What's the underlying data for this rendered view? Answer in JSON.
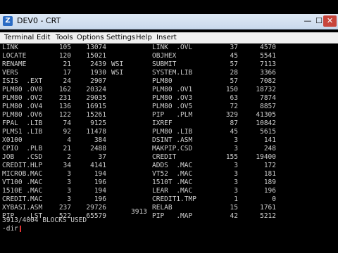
{
  "window": {
    "title": "DEV0 - CRT",
    "icon_name": "terminal-app-icon",
    "min_glyph": "—",
    "max_glyph": "☐",
    "close_glyph": "✕"
  },
  "menu": {
    "items": [
      "Terminal",
      "Edit",
      "Tools",
      "Options",
      "Settings",
      "Help",
      "Insert"
    ]
  },
  "listing": {
    "left": [
      {
        "name": "LINK",
        "blocks": "105",
        "size": "13074",
        "user": ""
      },
      {
        "name": "LOCATE",
        "blocks": "120",
        "size": "15021",
        "user": ""
      },
      {
        "name": "RENAME",
        "blocks": "21",
        "size": "2439",
        "user": "WSI"
      },
      {
        "name": "VERS",
        "blocks": "17",
        "size": "1930",
        "user": "WSI"
      },
      {
        "name": "ISIS  .EXT",
        "blocks": "24",
        "size": "2907",
        "user": ""
      },
      {
        "name": "PLM80 .OV0",
        "blocks": "162",
        "size": "20324",
        "user": ""
      },
      {
        "name": "PLM80 .OV2",
        "blocks": "231",
        "size": "29035",
        "user": ""
      },
      {
        "name": "PLM80 .OV4",
        "blocks": "136",
        "size": "16915",
        "user": ""
      },
      {
        "name": "PLM80 .OV6",
        "blocks": "122",
        "size": "15261",
        "user": ""
      },
      {
        "name": "FPAL  .LIB",
        "blocks": "74",
        "size": "9125",
        "user": ""
      },
      {
        "name": "PLMS1 .LIB",
        "blocks": "92",
        "size": "11478",
        "user": ""
      },
      {
        "name": "X0100",
        "blocks": "4",
        "size": "384",
        "user": ""
      },
      {
        "name": "CPIO  .PLB",
        "blocks": "21",
        "size": "2488",
        "user": ""
      },
      {
        "name": "JOB   .CSD",
        "blocks": "2",
        "size": "37",
        "user": ""
      },
      {
        "name": "CREDIT.HLP",
        "blocks": "34",
        "size": "4141",
        "user": ""
      },
      {
        "name": "MICROB.MAC",
        "blocks": "3",
        "size": "194",
        "user": ""
      },
      {
        "name": "VT100 .MAC",
        "blocks": "3",
        "size": "196",
        "user": ""
      },
      {
        "name": "1510E .MAC",
        "blocks": "3",
        "size": "194",
        "user": ""
      },
      {
        "name": "CREDIT.MAC",
        "blocks": "3",
        "size": "196",
        "user": ""
      },
      {
        "name": "XYBASI.ASM",
        "blocks": "237",
        "size": "29726",
        "user": ""
      },
      {
        "name": "PIP   .LST",
        "blocks": "522",
        "size": "65579",
        "user": ""
      }
    ],
    "right": [
      {
        "name": "LINK  .OVL",
        "blocks": "37",
        "size": "4570"
      },
      {
        "name": "OBJHEX",
        "blocks": "45",
        "size": "5541"
      },
      {
        "name": "SUBMIT",
        "blocks": "57",
        "size": "7113"
      },
      {
        "name": "SYSTEM.LIB",
        "blocks": "28",
        "size": "3366"
      },
      {
        "name": "PLM80",
        "blocks": "57",
        "size": "7082"
      },
      {
        "name": "PLM80 .OV1",
        "blocks": "150",
        "size": "18732"
      },
      {
        "name": "PLM80 .OV3",
        "blocks": "63",
        "size": "7874"
      },
      {
        "name": "PLM80 .OV5",
        "blocks": "72",
        "size": "8857"
      },
      {
        "name": "PIP   .PLM",
        "blocks": "329",
        "size": "41305"
      },
      {
        "name": "IXREF",
        "blocks": "87",
        "size": "10842"
      },
      {
        "name": "PLM80 .LIB",
        "blocks": "45",
        "size": "5615"
      },
      {
        "name": "DSINT .ASM",
        "blocks": "3",
        "size": "141"
      },
      {
        "name": "MAKPIP.CSD",
        "blocks": "3",
        "size": "248"
      },
      {
        "name": "CREDIT",
        "blocks": "155",
        "size": "19400"
      },
      {
        "name": "ADDS  .MAC",
        "blocks": "3",
        "size": "172"
      },
      {
        "name": "VT52  .MAC",
        "blocks": "3",
        "size": "181"
      },
      {
        "name": "1510T .MAC",
        "blocks": "3",
        "size": "189"
      },
      {
        "name": "LEAR  .MAC",
        "blocks": "3",
        "size": "196"
      },
      {
        "name": "CREDIT1.TMP",
        "blocks": "1",
        "size": "0"
      },
      {
        "name": "RELAB",
        "blocks": "15",
        "size": "1761"
      },
      {
        "name": "PIP   .MAP",
        "blocks": "42",
        "size": "5212"
      }
    ],
    "total_blocks": "3913",
    "status": "3913/4004 BLOCKS USED",
    "prompt": "-dir"
  },
  "colors": {
    "terminal_bg": "#000000",
    "terminal_fg": "#cfcfcf",
    "cursor": "#dd3333",
    "close_button": "#c8453b"
  }
}
